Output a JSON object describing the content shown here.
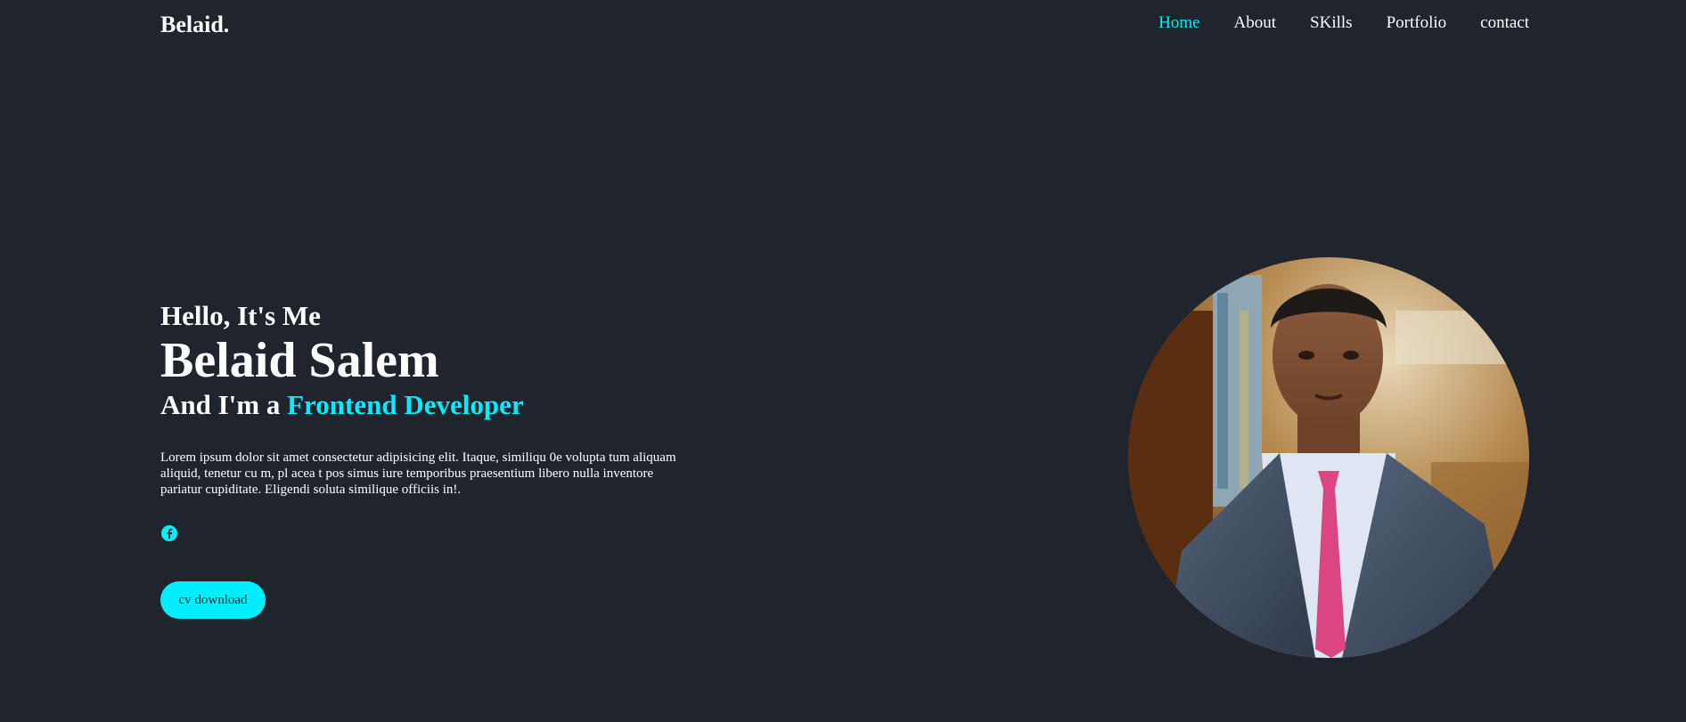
{
  "header": {
    "logo": "Belaid.",
    "nav": [
      {
        "label": "Home",
        "active": true
      },
      {
        "label": "About",
        "active": false
      },
      {
        "label": "SKills",
        "active": false
      },
      {
        "label": "Portfolio",
        "active": false
      },
      {
        "label": "contact",
        "active": false
      }
    ]
  },
  "hero": {
    "greeting": "Hello, It's Me",
    "name": "Belaid Salem",
    "role_prefix": "And I'm a ",
    "role": "Frontend Developer",
    "description": "Lorem ipsum dolor sit amet consectetur adipisicing elit. Itaque, similiqu 0e volupta tum aliquam aliquid, tenetur cu m, pl acea t pos simus iure temporibus praesentium libero nulla inventore pariatur cupiditate. Eligendi soluta similique officiis in!.",
    "social_icon": "facebook-icon",
    "cta_label": "cv download"
  },
  "colors": {
    "background": "#1f242d",
    "accent": "#00eeff",
    "text": "#ffffff"
  }
}
